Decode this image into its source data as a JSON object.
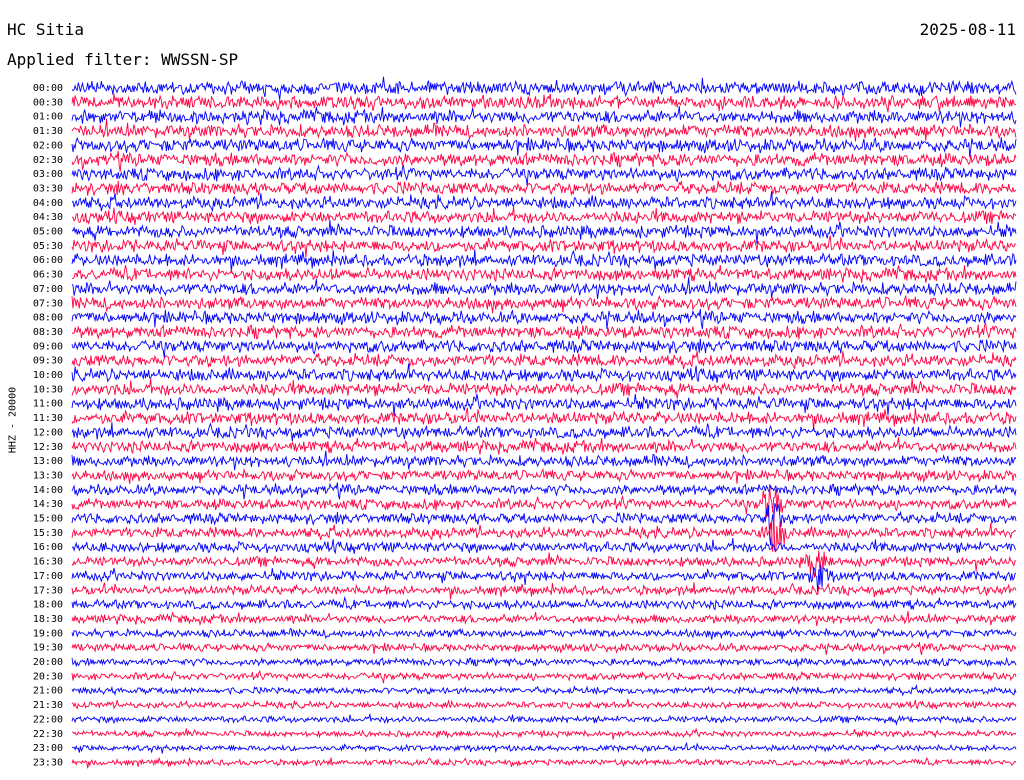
{
  "header": {
    "station": "HC Sitia",
    "date": "2025-08-11",
    "filter": "Applied filter: WWSSN-SP"
  },
  "chart_data": {
    "type": "line",
    "title": "HC Sitia",
    "ylabel": "HHZ - 20000",
    "row_labels": [
      "00:00",
      "00:30",
      "01:00",
      "01:30",
      "02:00",
      "02:30",
      "03:00",
      "03:30",
      "04:00",
      "04:30",
      "05:00",
      "05:30",
      "06:00",
      "06:30",
      "07:00",
      "07:30",
      "08:00",
      "08:30",
      "09:00",
      "09:30",
      "10:00",
      "10:30",
      "11:00",
      "11:30",
      "12:00",
      "12:30",
      "13:00",
      "13:30",
      "14:00",
      "14:30",
      "15:00",
      "15:30",
      "16:00",
      "16:30",
      "17:00",
      "17:30",
      "18:00",
      "18:30",
      "19:00",
      "19:30",
      "20:00",
      "20:30",
      "21:00",
      "21:30",
      "22:00",
      "22:30",
      "23:00",
      "23:30"
    ],
    "trace_colors": [
      "#0000ff",
      "#ff0040"
    ],
    "noise_amplitude_by_row": [
      1.0,
      1.0,
      1.0,
      1.0,
      1.0,
      1.0,
      0.95,
      0.95,
      0.95,
      0.95,
      0.95,
      0.95,
      0.95,
      0.95,
      0.95,
      0.95,
      0.95,
      0.95,
      0.95,
      0.95,
      0.95,
      0.95,
      0.95,
      0.95,
      0.9,
      0.9,
      0.85,
      0.8,
      0.8,
      0.8,
      0.8,
      0.8,
      0.8,
      0.75,
      0.75,
      0.7,
      0.7,
      0.65,
      0.6,
      0.6,
      0.55,
      0.55,
      0.5,
      0.5,
      0.5,
      0.45,
      0.45,
      0.45
    ],
    "events": [
      {
        "row": 29,
        "time_fraction": 0.74,
        "amplitude": 4.0
      },
      {
        "row": 30,
        "time_fraction": 0.74,
        "amplitude": 5.0
      },
      {
        "row": 31,
        "time_fraction": 0.745,
        "amplitude": 4.0
      },
      {
        "row": 33,
        "time_fraction": 0.79,
        "amplitude": 3.0
      },
      {
        "row": 34,
        "time_fraction": 0.79,
        "amplitude": 3.0
      }
    ]
  }
}
